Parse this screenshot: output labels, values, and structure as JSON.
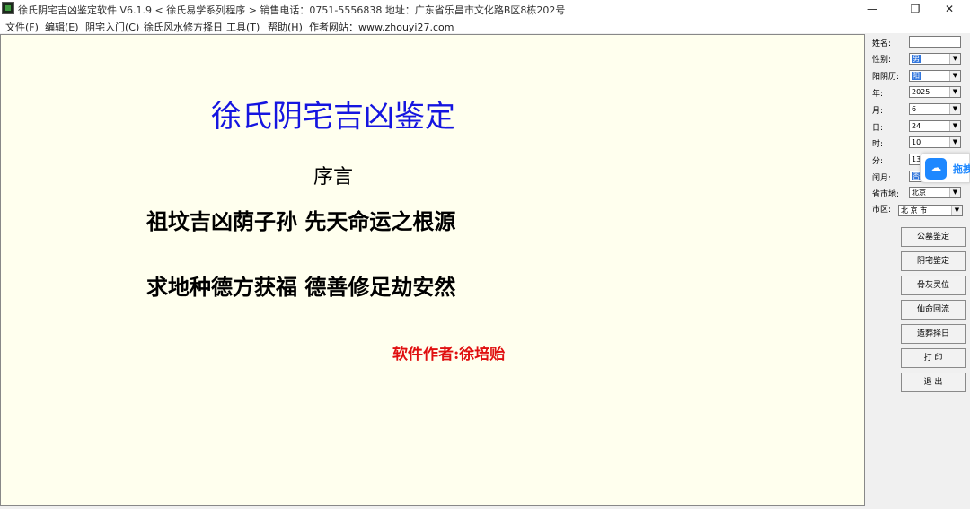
{
  "window": {
    "title": "徐氏阴宅吉凶鉴定软件 V6.1.9  < 徐氏易学系列程序 >   销售电话：0751-5556838    地址：广东省乐昌市文化路B区8栋202号",
    "minimize": "—",
    "restore": "❐",
    "close": "✕"
  },
  "menu": [
    "文件(F)",
    "编辑(E)",
    "阴宅入门(C)",
    "徐氏风水修方择日",
    "工具(T)",
    "帮助(H)",
    "作者网站：www.zhouyi27.com"
  ],
  "canvas": {
    "title": "徐氏阴宅吉凶鉴定",
    "preface": "序言",
    "verse1": "祖坟吉凶荫子孙   先天命运之根源",
    "verse2": "求地种德方获福   德善修足劫安然",
    "author": "软件作者:徐培贻"
  },
  "form": {
    "name_label": "姓名:",
    "name_value": "",
    "gender_label": "性别:",
    "gender_value": "男",
    "calendar_label": "阳阴历:",
    "calendar_value": "阳",
    "year_label": "年:",
    "year_value": "2025",
    "month_label": "月:",
    "month_value": "6",
    "day_label": "日:",
    "day_value": "24",
    "hour_label": "时:",
    "hour_value": "10",
    "minute_label": "分:",
    "minute_value": "13",
    "leap_label": "闰月:",
    "leap_value": "否",
    "province_label": "省市地:",
    "province_value": "北京",
    "city_label": "市区:",
    "city_value": "北 京 市"
  },
  "buttons": [
    "公墓鉴定",
    "阴宅鉴定",
    "骨灰灵位",
    "仙命回流",
    "造葬择日",
    "打  印",
    "退  出"
  ],
  "floating_widget": {
    "label": "拖拽"
  }
}
